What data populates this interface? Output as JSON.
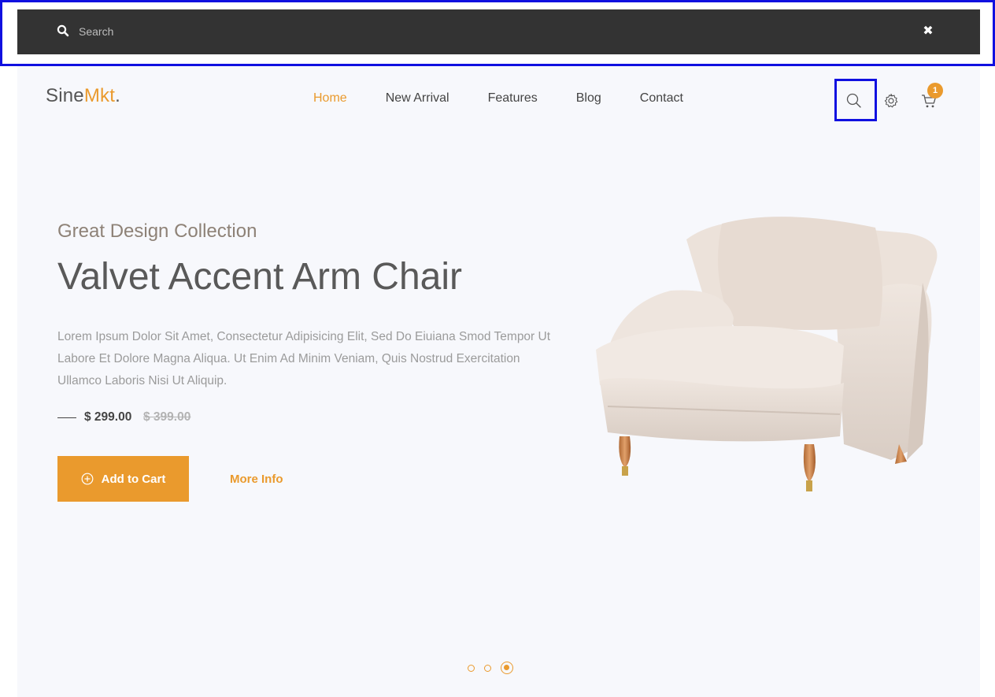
{
  "search": {
    "placeholder": "Search",
    "value": ""
  },
  "logo": {
    "part1": "Sine",
    "part2": "Mkt",
    "dot": "."
  },
  "nav": {
    "items": [
      {
        "label": "Home",
        "active": true
      },
      {
        "label": "New Arrival",
        "active": false
      },
      {
        "label": "Features",
        "active": false
      },
      {
        "label": "Blog",
        "active": false
      },
      {
        "label": "Contact",
        "active": false
      }
    ]
  },
  "header_icons": [
    "search-icon",
    "gear-icon",
    "cart-icon"
  ],
  "cart": {
    "count": "1"
  },
  "hero": {
    "subtitle": "Great Design Collection",
    "title": "Valvet Accent Arm Chair",
    "description": "Lorem Ipsum Dolor Sit Amet, Consectetur Adipisicing Elit, Sed Do Eiuiana Smod Tempor Ut Labore Et Dolore Magna Aliqua. Ut Enim Ad Minim Veniam, Quis Nostrud Exercitation Ullamco Laboris Nisi Ut Aliquip.",
    "price": "$ 299.00",
    "old_price": "$ 399.00",
    "add_to_cart": "Add to Cart",
    "more_info": "More Info"
  },
  "slider": {
    "count": 3,
    "active": 3
  },
  "colors": {
    "accent": "#ea9a2d",
    "search_bar_bg": "#333333",
    "page_bg": "#f7f8fc"
  }
}
